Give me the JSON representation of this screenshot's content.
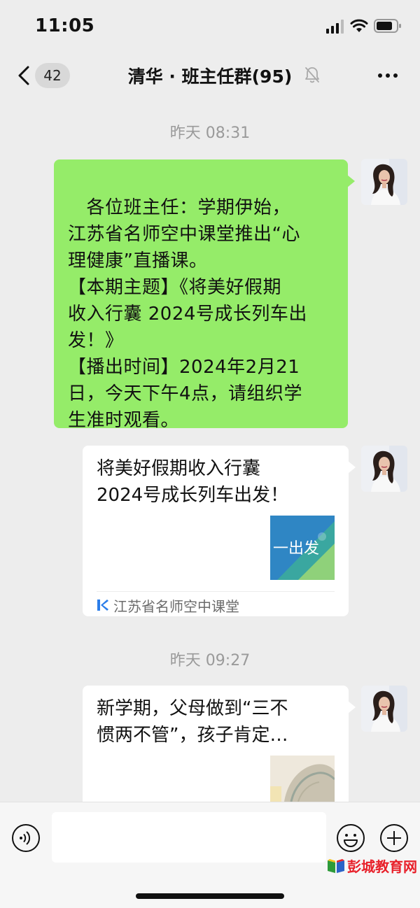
{
  "status_bar": {
    "time": "11:05"
  },
  "nav": {
    "unread_count": "42",
    "title": "清华 · 班主任群(95)"
  },
  "timestamps": [
    "昨天 08:31",
    "昨天 09:27"
  ],
  "message_text": {
    "lines": [
      "　各位班主任：学期伊始，",
      "江苏省名师空中课堂推出“心",
      "理健康”直播课。",
      "【本期主题】《将美好假期",
      "收入行囊 2024号成长列车出",
      "发！》",
      "【播出时间】2024年2月21",
      "日，今天下午4点，请组织学",
      "生准时观看。"
    ]
  },
  "card1": {
    "title_lines": [
      "将美好假期收入行囊",
      "2024号成长列车出发！"
    ],
    "thumb_text": "一出发",
    "source": "江苏省名师空中课堂"
  },
  "card2": {
    "title_lines": [
      "新学期，父母做到“三不",
      "惯两不管”，孩子肯定…"
    ]
  },
  "watermark": {
    "text": "彭城教育网"
  },
  "colors": {
    "bubble_green": "#95ec69",
    "chat_background": "#ededed",
    "timestamp_gray": "#9a9a9a",
    "watermark_red": "#e8202a"
  },
  "icons": {
    "back": "chevron-left-icon",
    "mute": "bell-slash-icon",
    "more": "more-dots-icon",
    "voice": "voice-icon",
    "emoji": "emoji-icon",
    "plus": "plus-icon"
  }
}
